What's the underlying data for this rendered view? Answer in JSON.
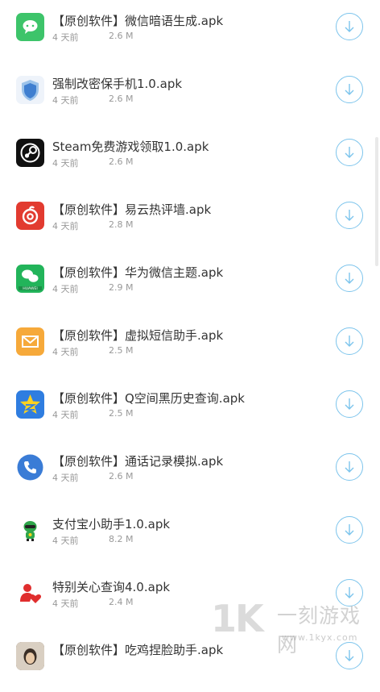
{
  "apps": [
    {
      "title": "【原创软件】微信暗语生成.apk",
      "time": "4 天前",
      "size": "2.6 M",
      "icon": "wechat-chat-icon"
    },
    {
      "title": "强制改密保手机1.0.apk",
      "time": "4 天前",
      "size": "2.6 M",
      "icon": "shield-icon"
    },
    {
      "title": "Steam免费游戏领取1.0.apk",
      "time": "4 天前",
      "size": "2.6 M",
      "icon": "steam-icon"
    },
    {
      "title": "【原创软件】易云热评墙.apk",
      "time": "4 天前",
      "size": "2.8 M",
      "icon": "netease-music-icon"
    },
    {
      "title": "【原创软件】华为微信主题.apk",
      "time": "4 天前",
      "size": "2.9 M",
      "icon": "huawei-wechat-icon"
    },
    {
      "title": "【原创软件】虚拟短信助手.apk",
      "time": "4 天前",
      "size": "2.5 M",
      "icon": "envelope-icon"
    },
    {
      "title": "【原创软件】Q空间黑历史查询.apk",
      "time": "4 天前",
      "size": "2.5 M",
      "icon": "qzone-star-icon"
    },
    {
      "title": "【原创软件】通话记录模拟.apk",
      "time": "4 天前",
      "size": "2.6 M",
      "icon": "phone-icon"
    },
    {
      "title": "支付宝小助手1.0.apk",
      "time": "4 天前",
      "size": "8.2 M",
      "icon": "robot-icon"
    },
    {
      "title": "特别关心查询4.0.apk",
      "time": "4 天前",
      "size": "2.4 M",
      "icon": "heart-person-icon"
    },
    {
      "title": "【原创软件】吃鸡捏脸助手.apk",
      "time": "",
      "size": "",
      "icon": "avatar-icon"
    }
  ],
  "watermark": {
    "logo": "1K",
    "name": "一刻游戏网",
    "url": "www.1kyx.com"
  },
  "colors": {
    "accent": "#7cc4ec",
    "title": "#333333",
    "meta": "#999999"
  }
}
